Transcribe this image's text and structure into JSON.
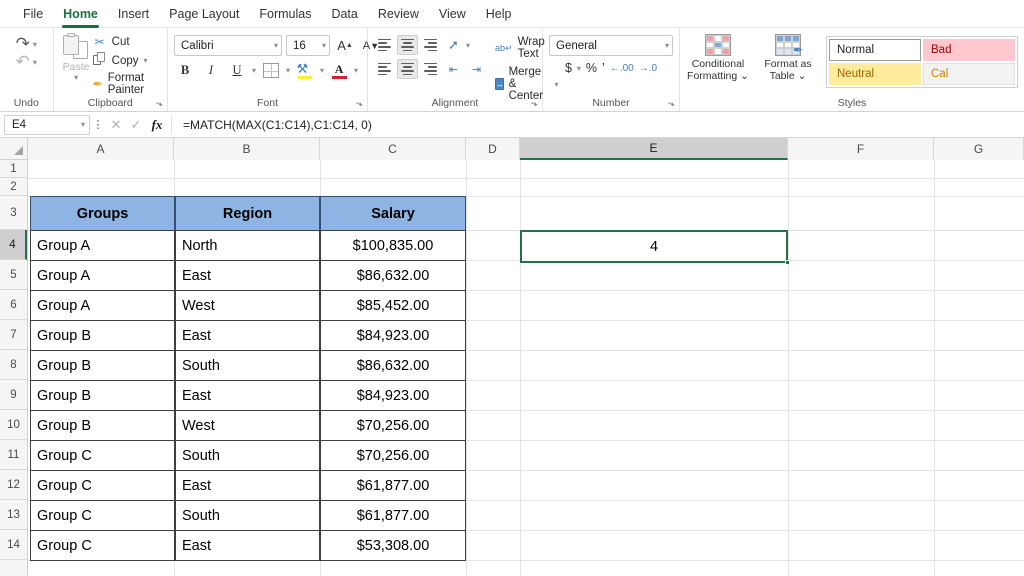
{
  "menubar": {
    "items": [
      {
        "label": "File",
        "active": false
      },
      {
        "label": "Home",
        "active": true
      },
      {
        "label": "Insert",
        "active": false
      },
      {
        "label": "Page Layout",
        "active": false
      },
      {
        "label": "Formulas",
        "active": false
      },
      {
        "label": "Data",
        "active": false
      },
      {
        "label": "Review",
        "active": false
      },
      {
        "label": "View",
        "active": false
      },
      {
        "label": "Help",
        "active": false
      }
    ]
  },
  "ribbon": {
    "undo": {
      "group_label": "Undo",
      "undo_icon": "undo-arrow-icon",
      "redo_icon": "redo-arrow-icon"
    },
    "clipboard": {
      "group_label": "Clipboard",
      "paste_label": "Paste",
      "cut_label": "Cut",
      "copy_label": "Copy",
      "format_painter_label": "Format Painter",
      "dialog_launcher": "⬎"
    },
    "font": {
      "group_label": "Font",
      "font_name": "Calibri",
      "font_size": "16",
      "grow_font": "A",
      "shrink_font": "A",
      "bold": "B",
      "italic": "I",
      "underline": "U",
      "dialog_launcher": "⬎"
    },
    "alignment": {
      "group_label": "Alignment",
      "wrap_text_label": "Wrap Text",
      "merge_center_label": "Merge & Center",
      "dialog_launcher": "⬎"
    },
    "number": {
      "group_label": "Number",
      "format": "General",
      "currency": "$",
      "percent": "%",
      "comma": "’",
      "increase_decimal": "←.00",
      "decrease_decimal": "→.0",
      "dialog_launcher": "⬎"
    },
    "styles": {
      "group_label": "Styles",
      "conditional_formatting_line1": "Conditional",
      "conditional_formatting_line2": "Formatting ⌄",
      "format_as_table_line1": "Format as",
      "format_as_table_line2": "Table ⌄",
      "gallery": [
        {
          "label": "Normal",
          "style": "normal"
        },
        {
          "label": "Bad",
          "style": "bad"
        },
        {
          "label": "Neutral",
          "style": "neutral"
        },
        {
          "label": "Cal",
          "style": "calc"
        }
      ]
    }
  },
  "formula_bar": {
    "name_box": "E4",
    "name_box_caret": "⌄",
    "more_icon": "⋮",
    "cancel_icon": "✕",
    "enter_icon": "✓",
    "function_icon": "fx",
    "formula": "=MATCH(MAX(C1:C14),C1:C14, 0)"
  },
  "grid": {
    "column_headers": [
      {
        "label": "A",
        "selected": false
      },
      {
        "label": "B",
        "selected": false
      },
      {
        "label": "C",
        "selected": false
      },
      {
        "label": "D",
        "selected": false
      },
      {
        "label": "E",
        "selected": true
      },
      {
        "label": "F",
        "selected": false
      },
      {
        "label": "G",
        "selected": false
      }
    ],
    "row_headers": [
      {
        "label": "1",
        "selected": false
      },
      {
        "label": "2",
        "selected": false
      },
      {
        "label": "3",
        "selected": false
      },
      {
        "label": "4",
        "selected": true
      },
      {
        "label": "5",
        "selected": false
      },
      {
        "label": "6",
        "selected": false
      },
      {
        "label": "7",
        "selected": false
      },
      {
        "label": "8",
        "selected": false
      },
      {
        "label": "9",
        "selected": false
      },
      {
        "label": "10",
        "selected": false
      },
      {
        "label": "11",
        "selected": false
      },
      {
        "label": "12",
        "selected": false
      },
      {
        "label": "13",
        "selected": false
      },
      {
        "label": "14",
        "selected": false
      }
    ],
    "table": {
      "header_row": [
        "Groups",
        "Region",
        "Salary"
      ],
      "header_fill": "#8db4e2",
      "rows": [
        {
          "row": "4",
          "groups": "Group A",
          "region": "North",
          "salary": "$100,835.00"
        },
        {
          "row": "5",
          "groups": "Group A",
          "region": "East",
          "salary": "$86,632.00"
        },
        {
          "row": "6",
          "groups": "Group A",
          "region": "West",
          "salary": "$85,452.00"
        },
        {
          "row": "7",
          "groups": "Group B",
          "region": "East",
          "salary": "$84,923.00"
        },
        {
          "row": "8",
          "groups": "Group B",
          "region": "South",
          "salary": "$86,632.00"
        },
        {
          "row": "9",
          "groups": "Group B",
          "region": "East",
          "salary": "$84,923.00"
        },
        {
          "row": "10",
          "groups": "Group B",
          "region": "West",
          "salary": "$70,256.00"
        },
        {
          "row": "11",
          "groups": "Group C",
          "region": "South",
          "salary": "$70,256.00"
        },
        {
          "row": "12",
          "groups": "Group C",
          "region": "East",
          "salary": "$61,877.00"
        },
        {
          "row": "13",
          "groups": "Group C",
          "region": "South",
          "salary": "$61,877.00"
        },
        {
          "row": "14",
          "groups": "Group C",
          "region": "East",
          "salary": "$53,308.00"
        }
      ]
    },
    "selected_cell": {
      "ref": "E4",
      "value": "4"
    }
  },
  "colors": {
    "accent_green": "#217346",
    "header_blue": "#8db4e2",
    "bad_style": "#ffc7ce",
    "neutral_style": "#ffeb9c"
  }
}
